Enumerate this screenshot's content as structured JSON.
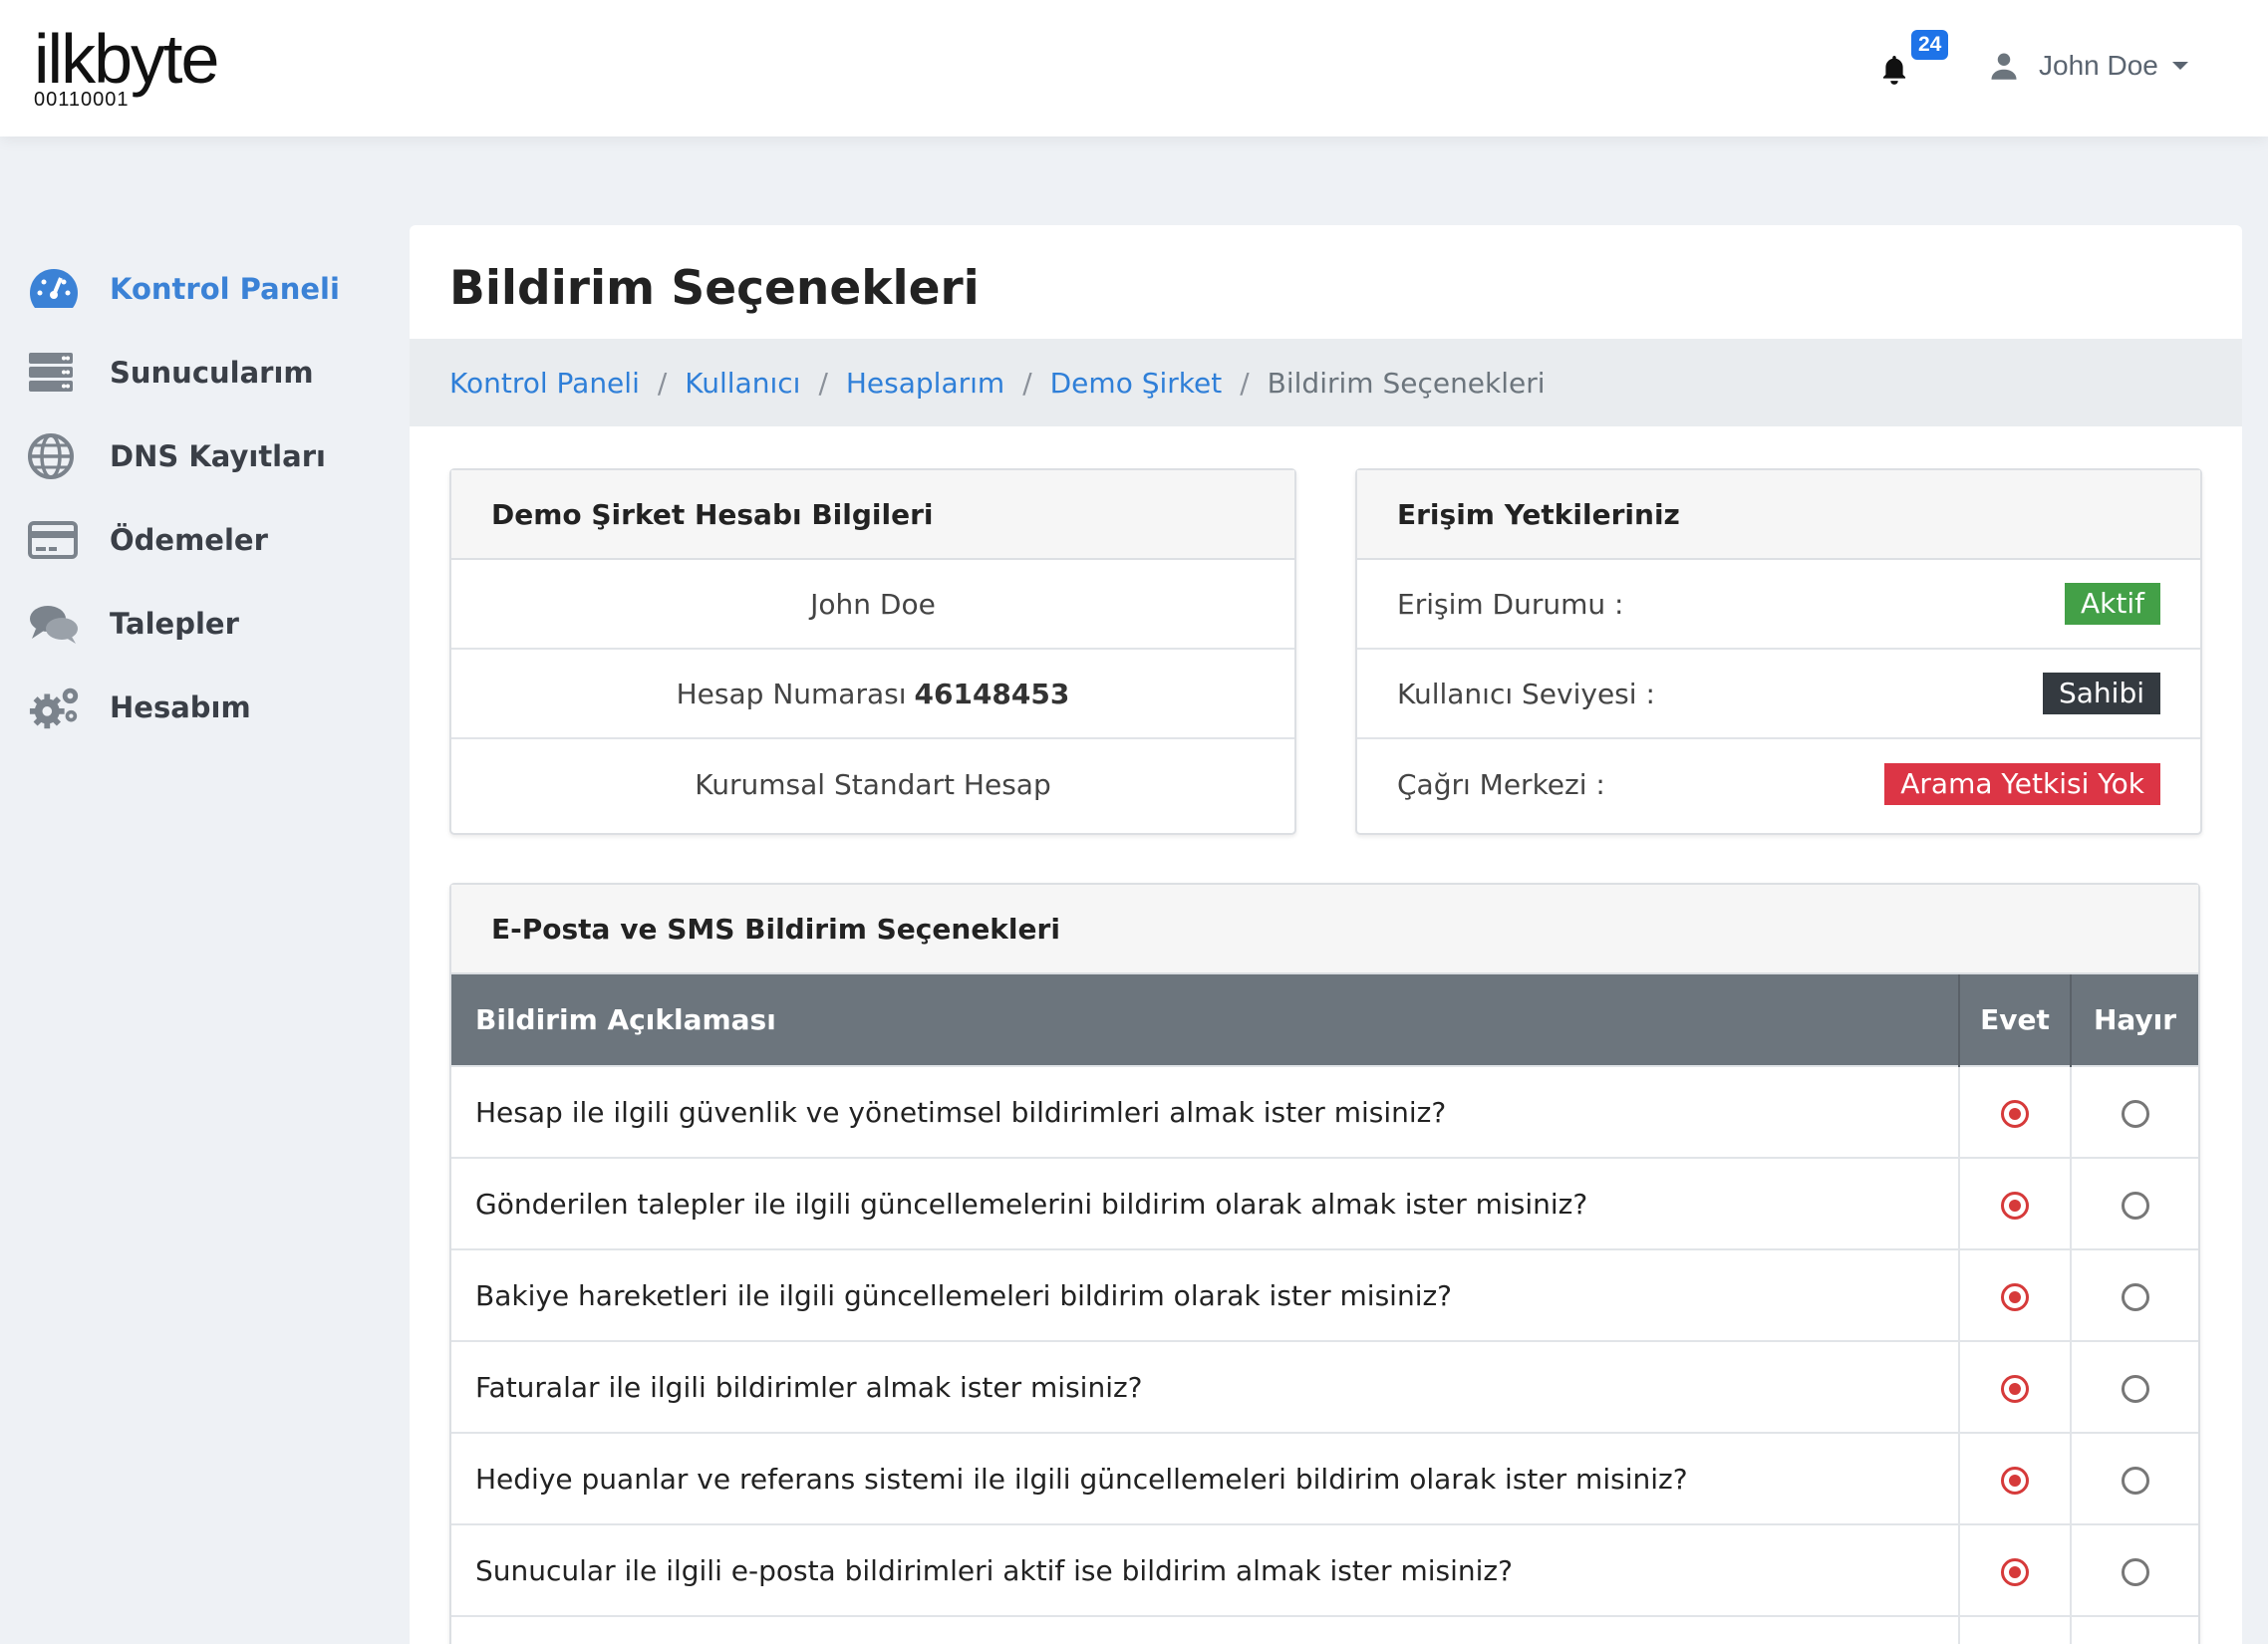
{
  "brand": {
    "word": "ilkbyte",
    "binary": "00110001"
  },
  "header": {
    "notification_count": "24",
    "user_name": "John Doe"
  },
  "sidebar": {
    "items": [
      {
        "label": "Kontrol Paneli",
        "icon": "dashboard-gauge-icon",
        "active": true
      },
      {
        "label": "Sunucularım",
        "icon": "server-icon",
        "active": false
      },
      {
        "label": "DNS Kayıtları",
        "icon": "globe-icon",
        "active": false
      },
      {
        "label": "Ödemeler",
        "icon": "credit-card-icon",
        "active": false
      },
      {
        "label": "Talepler",
        "icon": "chat-bubbles-icon",
        "active": false
      },
      {
        "label": "Hesabım",
        "icon": "gears-icon",
        "active": false
      }
    ]
  },
  "page": {
    "title": "Bildirim Seçenekleri",
    "breadcrumb": [
      "Kontrol Paneli",
      "Kullanıcı",
      "Hesaplarım",
      "Demo Şirket"
    ],
    "breadcrumb_current": "Bildirim Seçenekleri"
  },
  "account_card": {
    "title": "Demo Şirket Hesabı Bilgileri",
    "owner": "John Doe",
    "number_label": "Hesap Numarası",
    "number_value": "46148453",
    "plan": "Kurumsal Standart Hesap"
  },
  "access_card": {
    "title": "Erişim Yetkileriniz",
    "rows": [
      {
        "label": "Erişim Durumu :",
        "value": "Aktif",
        "color": "#43a047"
      },
      {
        "label": "Kullanıcı Seviyesi :",
        "value": "Sahibi",
        "color": "#343a40"
      },
      {
        "label": "Çağrı Merkezi :",
        "value": "Arama Yetkisi Yok",
        "color": "#dc3545"
      }
    ]
  },
  "notifications": {
    "title": "E-Posta ve SMS Bildirim Seçenekleri",
    "columns": {
      "desc": "Bildirim Açıklaması",
      "yes": "Evet",
      "no": "Hayır"
    },
    "rows": [
      {
        "text": "Hesap ile ilgili güvenlik ve yönetimsel bildirimleri almak ister misiniz?",
        "selected": "yes"
      },
      {
        "text": "Gönderilen talepler ile ilgili güncellemelerini bildirim olarak almak ister misiniz?",
        "selected": "yes"
      },
      {
        "text": "Bakiye hareketleri ile ilgili güncellemeleri bildirim olarak ister misiniz?",
        "selected": "yes"
      },
      {
        "text": "Faturalar ile ilgili bildirimler almak ister misiniz?",
        "selected": "yes"
      },
      {
        "text": "Hediye puanlar ve referans sistemi ile ilgili güncellemeleri bildirim olarak ister misiniz?",
        "selected": "yes"
      },
      {
        "text": "Sunucular ile ilgili e-posta bildirimleri aktif ise bildirim almak ister misiniz?",
        "selected": "yes"
      }
    ]
  },
  "colors": {
    "accent": "#3b82d6",
    "link": "#2f7fd8",
    "radio_on": "#d63a3a",
    "badge": "#1e73e8"
  }
}
